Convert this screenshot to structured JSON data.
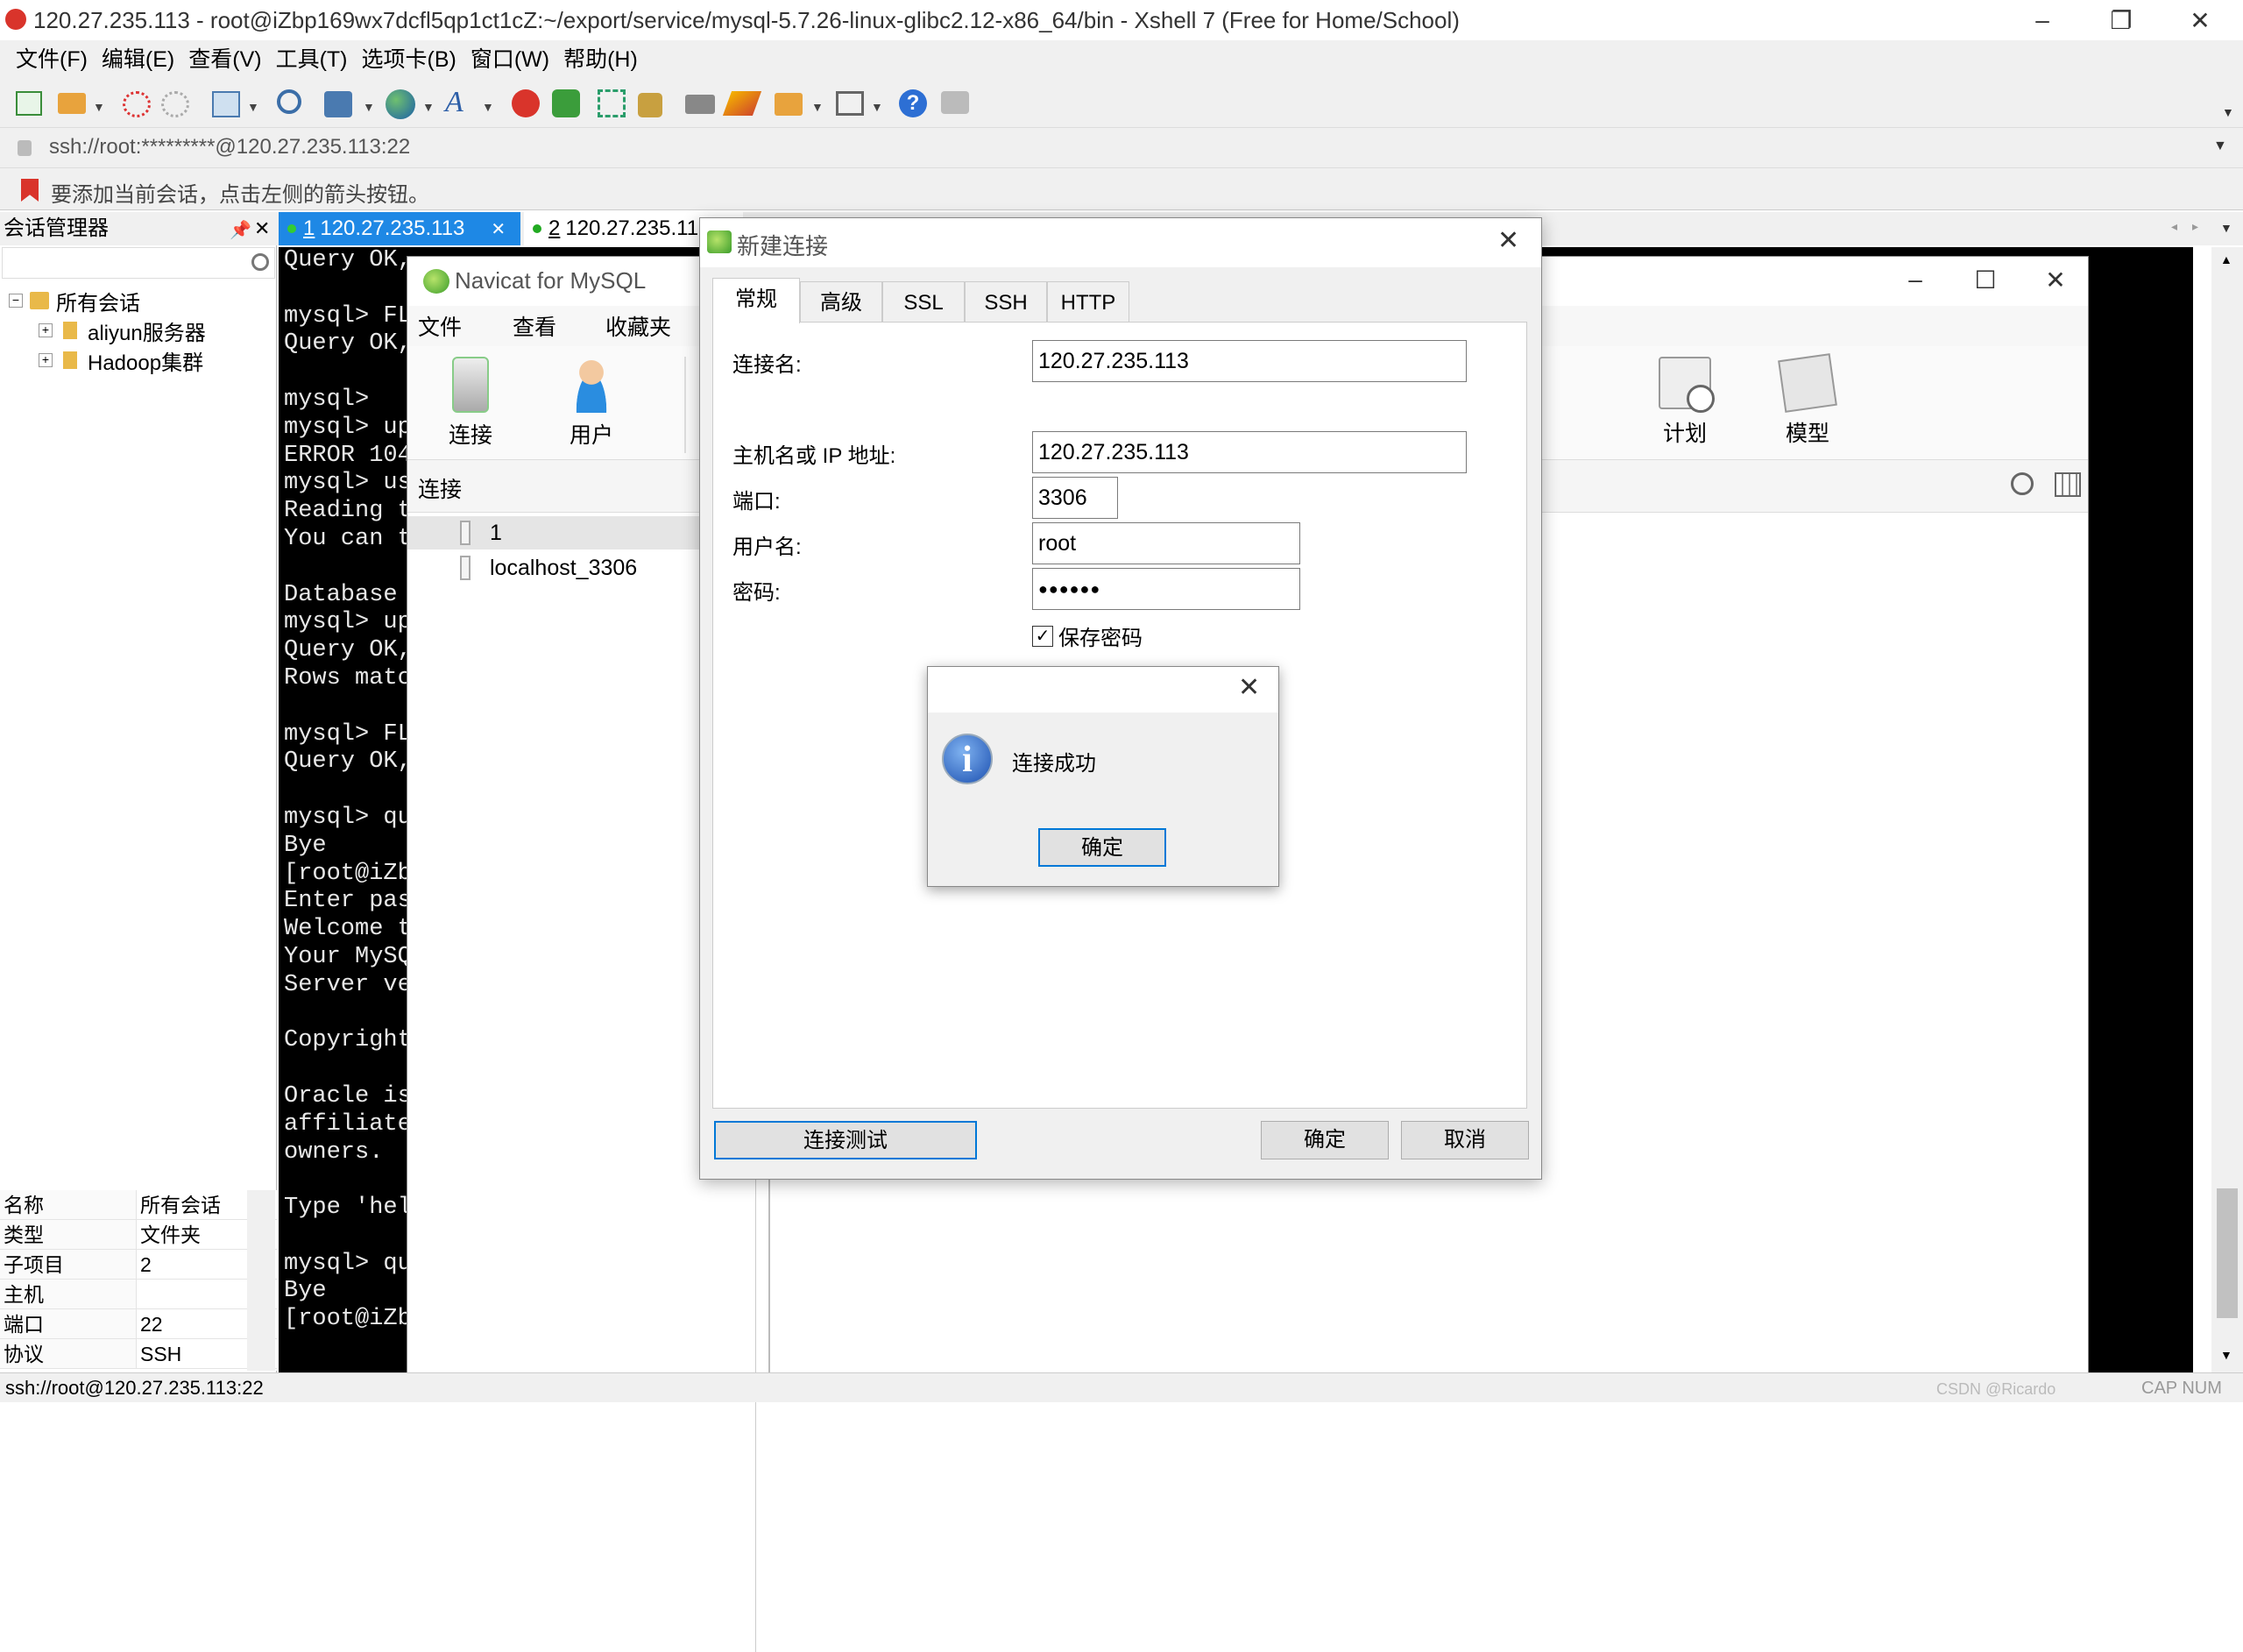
{
  "xshell": {
    "title": "120.27.235.113 - root@iZbp169wx7dcfl5qp1ct1cZ:~/export/service/mysql-5.7.26-linux-glibc2.12-x86_64/bin - Xshell 7 (Free for Home/School)",
    "menu": [
      "文件(F)",
      "编辑(E)",
      "查看(V)",
      "工具(T)",
      "选项卡(B)",
      "窗口(W)",
      "帮助(H)"
    ],
    "address": "ssh://root:*********@120.27.235.113:22",
    "hint": "要添加当前会话，点击左侧的箭头按钮。",
    "status": "ssh://root@120.27.235.113:22",
    "status_right": "CAP  NUM",
    "watermark": "CSDN @Ricardo"
  },
  "session_manager": {
    "title": "会话管理器",
    "tree": {
      "root": "所有会话",
      "children": [
        "aliyun服务器",
        "Hadoop集群"
      ]
    },
    "properties": [
      {
        "key": "名称",
        "value": "所有会话"
      },
      {
        "key": "类型",
        "value": "文件夹"
      },
      {
        "key": "子项目",
        "value": "2"
      },
      {
        "key": "主机",
        "value": ""
      },
      {
        "key": "端口",
        "value": "22"
      },
      {
        "key": "协议",
        "value": "SSH"
      }
    ]
  },
  "tabs": [
    {
      "num": "1",
      "label": "120.27.235.113"
    },
    {
      "num": "2",
      "label": "120.27.235.11"
    }
  ],
  "terminal": {
    "text": "Query OK,\n\nmysql> FL\nQuery OK,\n\nmysql>\nmysql> up\nERROR 104\nmysql> us\nReading t\nYou can t\n\nDatabase\nmysql> up\nQuery OK,\nRows matc\n\nmysql> FL\nQuery OK,\n\nmysql> qu\nBye\n[root@iZb\nEnter pas\nWelcome t\nYour MySQ\nServer ve\n\nCopyright\n\nOracle is\naffiliate\nowners.\n\nType 'hel\n\nmysql> qu\nBye\n[root@iZb"
  },
  "navicat": {
    "title": "Navicat for MySQL",
    "menu": [
      "文件",
      "查看",
      "收藏夹"
    ],
    "tools_left": [
      "连接",
      "用户"
    ],
    "tools_right": [
      "计划",
      "模型"
    ],
    "sub_label": "连接",
    "connections": [
      "1",
      "localhost_3306"
    ]
  },
  "dialog": {
    "title": "新建连接",
    "tabs": [
      "常规",
      "高级",
      "SSL",
      "SSH",
      "HTTP"
    ],
    "fields": {
      "conn_name_label": "连接名:",
      "conn_name": "120.27.235.113",
      "host_label": "主机名或 IP 地址:",
      "host": "120.27.235.113",
      "port_label": "端口:",
      "port": "3306",
      "user_label": "用户名:",
      "user": "root",
      "pwd_label": "密码:",
      "pwd": "●●●●●●",
      "save_pwd": "保存密码",
      "save_pwd_checked": true
    },
    "test_button": "连接测试",
    "ok_button": "确定",
    "cancel_button": "取消"
  },
  "msgbox": {
    "message": "连接成功",
    "ok": "确定"
  },
  "colors": {
    "tab_active": "#1e88e5",
    "terminal_bg": "#000000",
    "terminal_fg": "#e8e8e8",
    "focus_border": "#0078d7"
  }
}
